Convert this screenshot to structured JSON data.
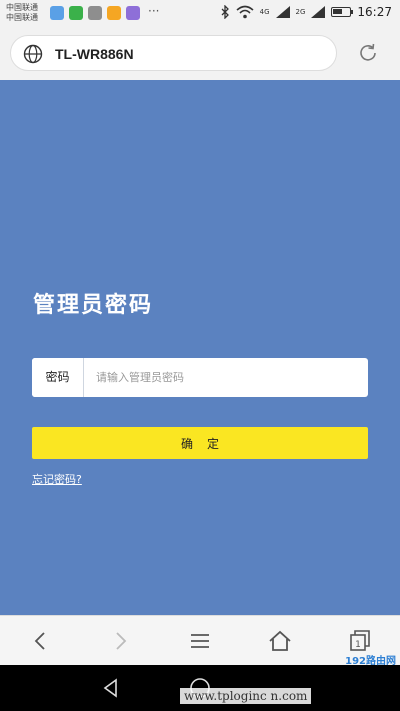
{
  "status_bar": {
    "carrier_line1": "中国联通",
    "carrier_line2": "中国联通",
    "more": "···",
    "net1": "4G",
    "net2": "2G",
    "battery_level": 0.6,
    "time": "16:27",
    "app_icon_colors": [
      "#5aa0e6",
      "#3bb14a",
      "#8e8e8e",
      "#f5a623",
      "#8e6fd8"
    ]
  },
  "browser": {
    "url": "TL-WR886N"
  },
  "login": {
    "title": "管理员密码",
    "password_label": "密码",
    "password_placeholder": "请输入管理员密码",
    "confirm_label": "确定",
    "forgot_label": "忘记密码?"
  },
  "watermark": {
    "url": "www.tploginc n.com",
    "logo": "192路由网"
  },
  "colors": {
    "background": "#5b82c0",
    "button": "#fae622"
  }
}
